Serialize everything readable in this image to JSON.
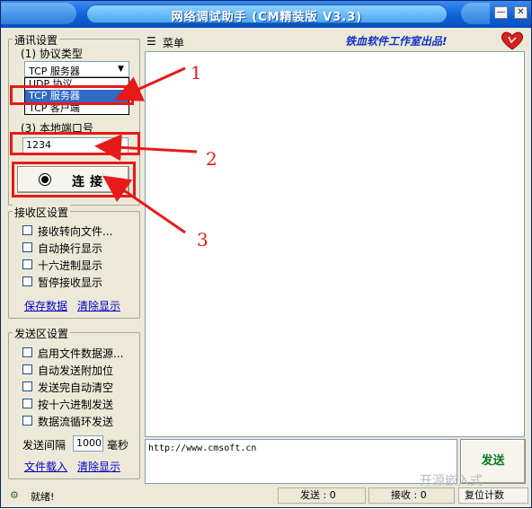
{
  "window": {
    "title": "网络调试助手 (CM精装版 V3.3)",
    "controls": {
      "minimize": "—",
      "maximize": "□",
      "close": "✕"
    }
  },
  "menu": {
    "label": "菜单",
    "brand": "铁血软件工作室出品!"
  },
  "comm_settings": {
    "title": "通讯设置",
    "protocol_label": "(1) 协议类型",
    "protocol_selected": "TCP 服务器",
    "protocol_options": [
      "TCP 服务器",
      "UDP 协议",
      "TCP 客户端"
    ],
    "port_label": "(3) 本地端口号",
    "port_value": "1234",
    "connect_label": "连接"
  },
  "receive_settings": {
    "title": "接收区设置",
    "options": [
      "接收转向文件...",
      "自动换行显示",
      "十六进制显示",
      "暂停接收显示"
    ],
    "save_link": "保存数据",
    "clear_link": "清除显示"
  },
  "send_settings": {
    "title": "发送区设置",
    "options": [
      "启用文件数据源...",
      "自动发送附加位",
      "发送完自动清空",
      "按十六进制发送",
      "数据流循环发送"
    ],
    "interval_label": "发送间隔",
    "interval_value": "1000",
    "interval_unit": "毫秒",
    "load_link": "文件载入",
    "clear_link": "清除显示"
  },
  "send_area": {
    "text": "http://www.cmsoft.cn",
    "send_button": "发送"
  },
  "status": {
    "ready": "就绪!",
    "send_label": "发送 : 0",
    "recv_label": "接收 : 0",
    "reset": "复位计数"
  },
  "annotations": {
    "n1": "1",
    "n2": "2",
    "n3": "3",
    "color": "#e81919"
  },
  "watermark": "开源嵌入式"
}
